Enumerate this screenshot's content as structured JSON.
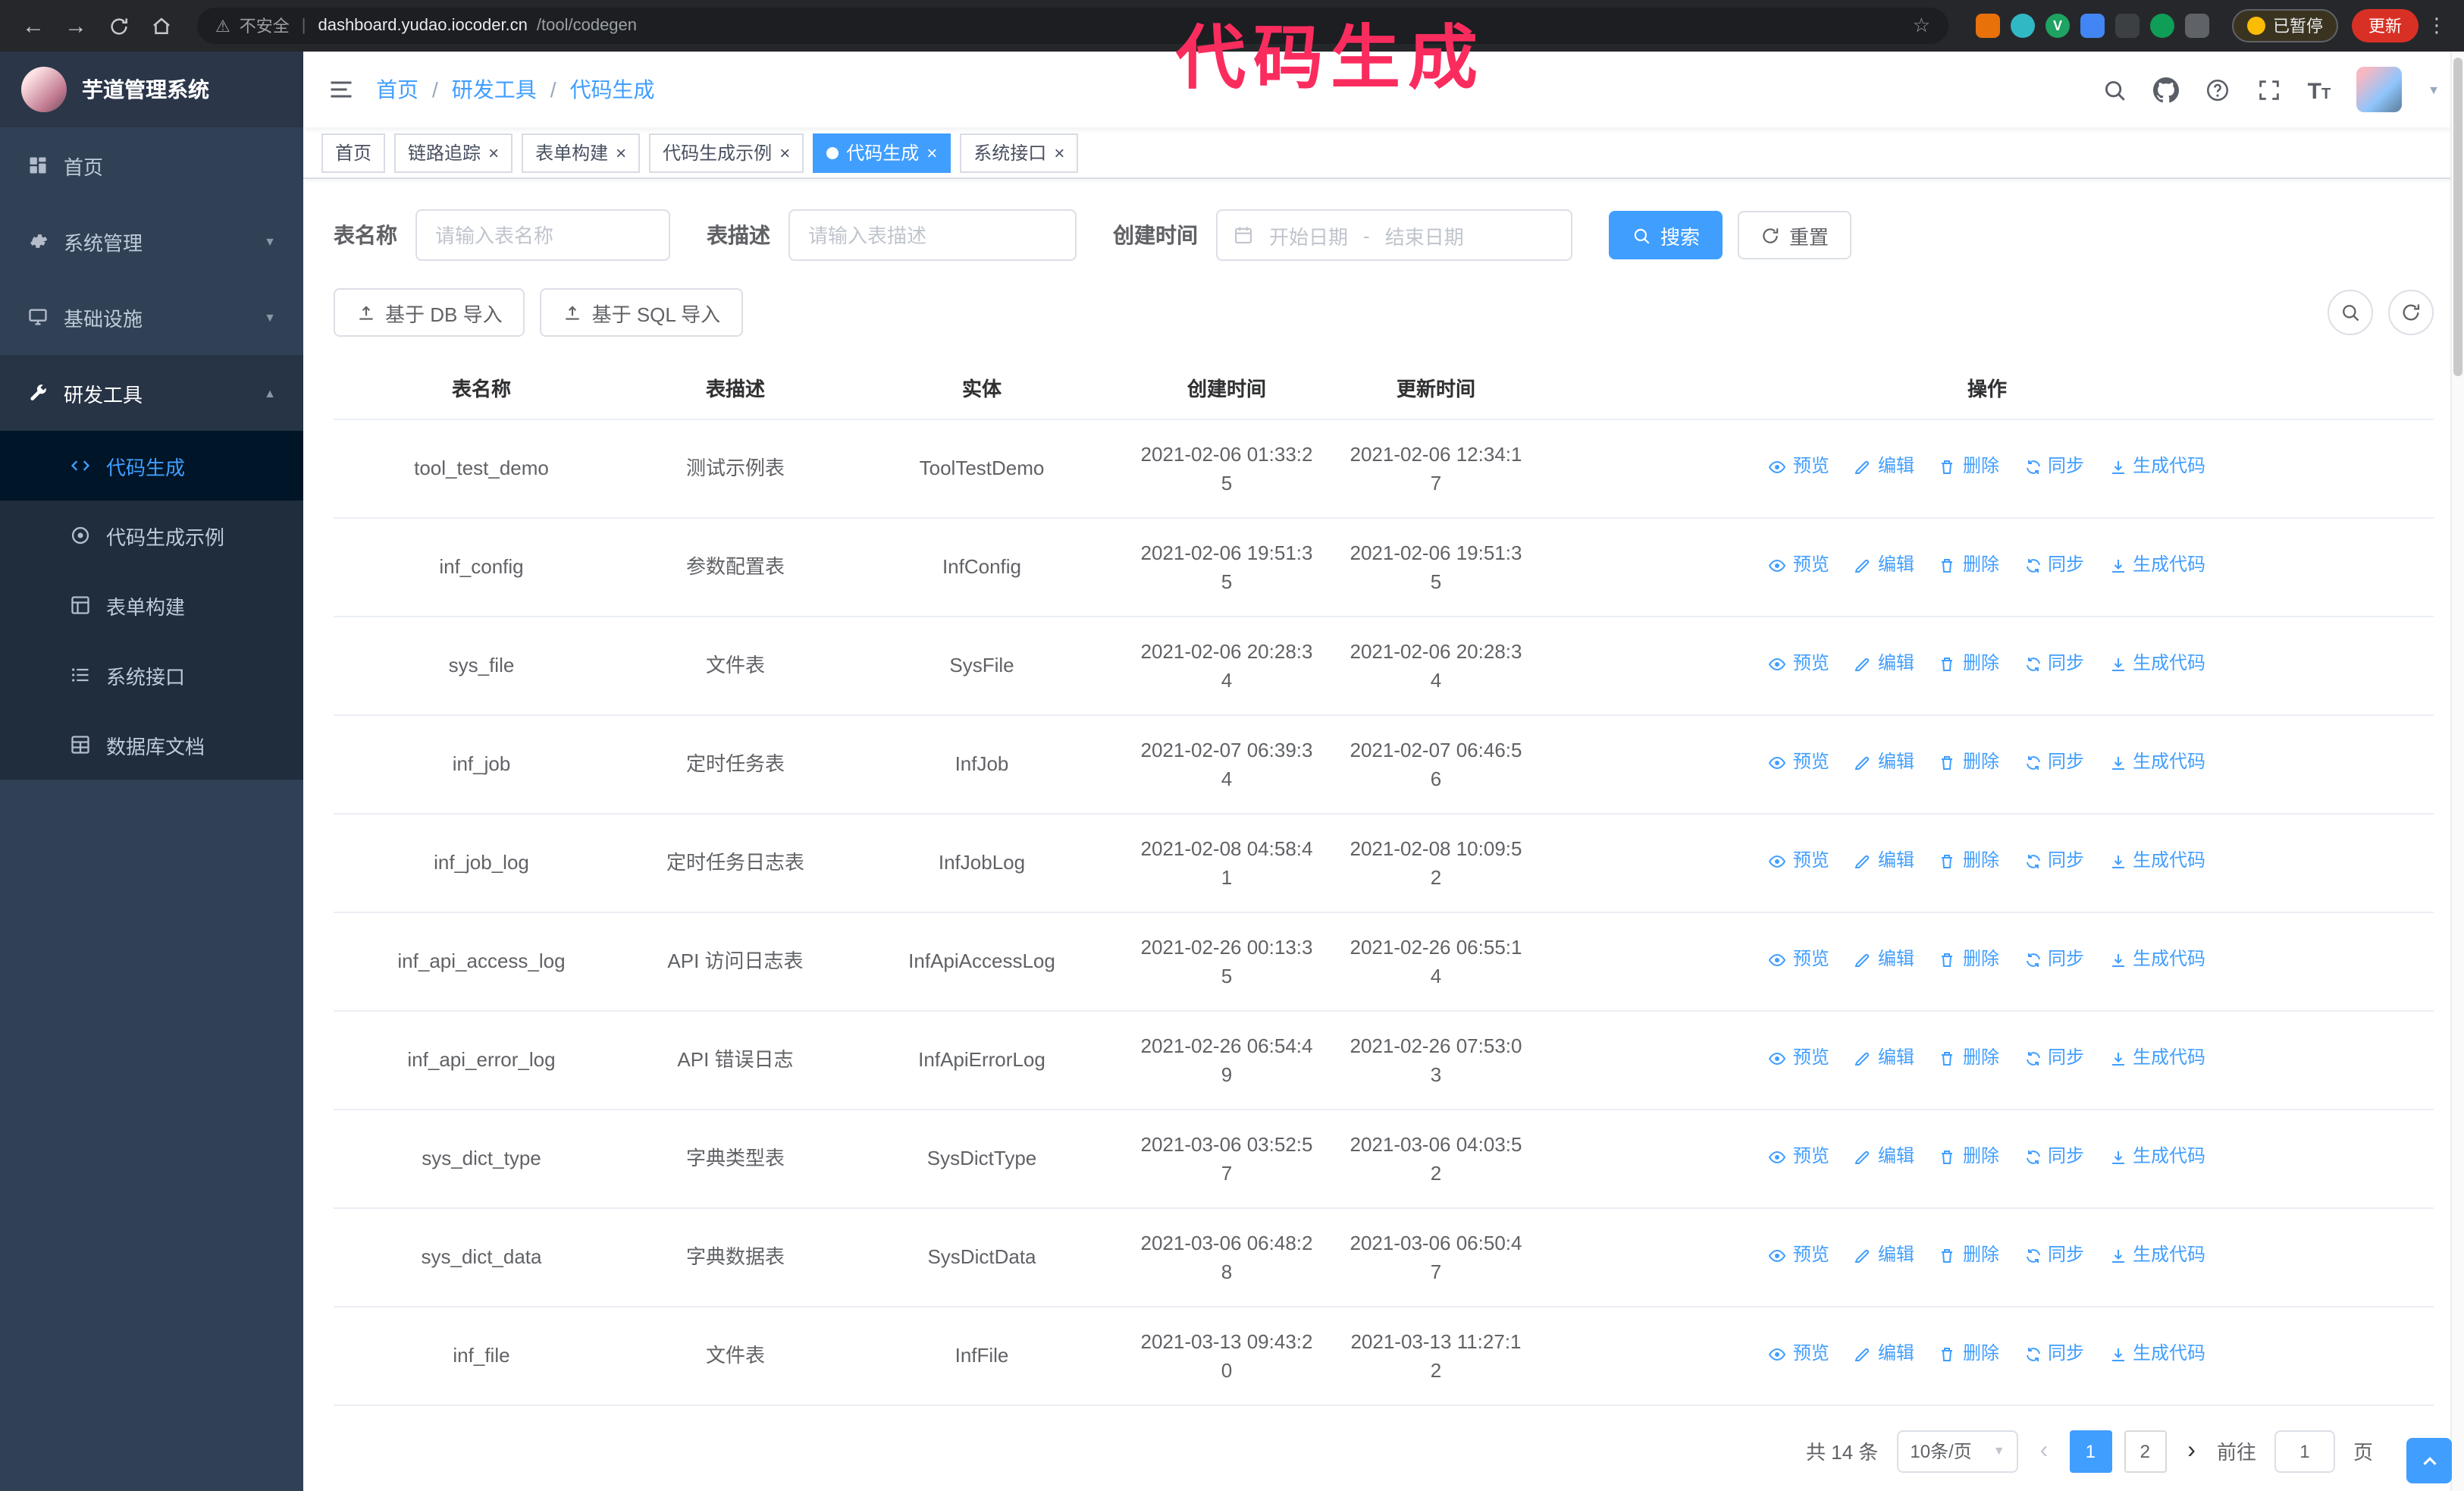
{
  "annotation": {
    "text": "代码生成"
  },
  "colors": {
    "primary": "#409eff",
    "sidebar_bg": "#304156",
    "submenu_bg": "#1f2d3d",
    "sidebar_active_bg": "#001528",
    "annotation": "#fa2c5e",
    "chrome_bg": "#26272b",
    "update_button": "#d93025"
  },
  "browser": {
    "security_label": "不安全",
    "url_host": "dashboard.yudao.iocoder.cn",
    "url_path": "/tool/codegen",
    "paused_label": "已暂停",
    "update_label": "更新",
    "extensions": [
      {
        "id": "fox-extension-icon",
        "color": "#e8710a",
        "shape": "square",
        "letter": ""
      },
      {
        "id": "teal-extension-icon",
        "color": "#30b8c4",
        "shape": "round",
        "letter": ""
      },
      {
        "id": "green-v-extension-icon",
        "color": "#1ea362",
        "shape": "round",
        "letter": "V"
      },
      {
        "id": "blue-grid-extension-icon",
        "color": "#4285f4",
        "shape": "square",
        "letter": ""
      },
      {
        "id": "dark-extension-icon",
        "color": "#3c4043",
        "shape": "square",
        "letter": ""
      },
      {
        "id": "leaf-extension-icon",
        "color": "#0f9d58",
        "shape": "round",
        "letter": ""
      },
      {
        "id": "grey-pin-extension-icon",
        "color": "#5f6368",
        "shape": "square",
        "letter": ""
      }
    ]
  },
  "sidebar": {
    "logo_title": "芋道管理系统",
    "items": [
      {
        "id": "home",
        "label": "首页",
        "icon": "dashboard"
      },
      {
        "id": "system-management",
        "label": "系统管理",
        "icon": "gear",
        "chevron": "down"
      },
      {
        "id": "infrastructure",
        "label": "基础设施",
        "icon": "monitor",
        "chevron": "down"
      },
      {
        "id": "dev-tools",
        "label": "研发工具",
        "icon": "wrench",
        "chevron": "up",
        "expanded": true
      }
    ],
    "subitems": [
      {
        "id": "codegen",
        "label": "代码生成",
        "icon": "code",
        "active": true
      },
      {
        "id": "codegen-example",
        "label": "代码生成示例",
        "icon": "target"
      },
      {
        "id": "form-builder",
        "label": "表单构建",
        "icon": "form"
      },
      {
        "id": "system-api",
        "label": "系统接口",
        "icon": "list"
      },
      {
        "id": "db-doc",
        "label": "数据库文档",
        "icon": "db"
      }
    ]
  },
  "header": {
    "breadcrumb": [
      "首页",
      "研发工具",
      "代码生成"
    ]
  },
  "tabs": [
    {
      "id": "home",
      "label": "首页",
      "closable": false,
      "active": false
    },
    {
      "id": "tracing",
      "label": "链路追踪",
      "closable": true,
      "active": false
    },
    {
      "id": "form-builder",
      "label": "表单构建",
      "closable": true,
      "active": false
    },
    {
      "id": "codegen-example",
      "label": "代码生成示例",
      "closable": true,
      "active": false
    },
    {
      "id": "codegen",
      "label": "代码生成",
      "closable": true,
      "active": true
    },
    {
      "id": "system-api",
      "label": "系统接口",
      "closable": true,
      "active": false
    }
  ],
  "filters": {
    "table_name_label": "表名称",
    "table_name_placeholder": "请输入表名称",
    "table_desc_label": "表描述",
    "table_desc_placeholder": "请输入表描述",
    "create_time_label": "创建时间",
    "date_start_placeholder": "开始日期",
    "date_separator": "-",
    "date_end_placeholder": "结束日期",
    "search_button": "搜索",
    "reset_button": "重置"
  },
  "toolbar": {
    "import_db_label": "基于 DB 导入",
    "import_sql_label": "基于 SQL 导入"
  },
  "table": {
    "columns": [
      "表名称",
      "表描述",
      "实体",
      "创建时间",
      "更新时间",
      "操作"
    ],
    "actions": [
      "预览",
      "编辑",
      "删除",
      "同步",
      "生成代码"
    ],
    "action_names": [
      "preview",
      "edit",
      "delete",
      "sync",
      "generate-code"
    ],
    "action_icons": [
      "eye-icon",
      "edit-icon",
      "trash-icon",
      "sync-icon",
      "download-icon"
    ],
    "rows": [
      {
        "name": "tool_test_demo",
        "desc": "测试示例表",
        "entity": "ToolTestDemo",
        "created": "2021-02-06 01:33:25",
        "updated": "2021-02-06 12:34:17"
      },
      {
        "name": "inf_config",
        "desc": "参数配置表",
        "entity": "InfConfig",
        "created": "2021-02-06 19:51:35",
        "updated": "2021-02-06 19:51:35"
      },
      {
        "name": "sys_file",
        "desc": "文件表",
        "entity": "SysFile",
        "created": "2021-02-06 20:28:34",
        "updated": "2021-02-06 20:28:34"
      },
      {
        "name": "inf_job",
        "desc": "定时任务表",
        "entity": "InfJob",
        "created": "2021-02-07 06:39:34",
        "updated": "2021-02-07 06:46:56"
      },
      {
        "name": "inf_job_log",
        "desc": "定时任务日志表",
        "entity": "InfJobLog",
        "created": "2021-02-08 04:58:41",
        "updated": "2021-02-08 10:09:52"
      },
      {
        "name": "inf_api_access_log",
        "desc": "API 访问日志表",
        "entity": "InfApiAccessLog",
        "created": "2021-02-26 00:13:35",
        "updated": "2021-02-26 06:55:14"
      },
      {
        "name": "inf_api_error_log",
        "desc": "API 错误日志",
        "entity": "InfApiErrorLog",
        "created": "2021-02-26 06:54:49",
        "updated": "2021-02-26 07:53:03"
      },
      {
        "name": "sys_dict_type",
        "desc": "字典类型表",
        "entity": "SysDictType",
        "created": "2021-03-06 03:52:57",
        "updated": "2021-03-06 04:03:52"
      },
      {
        "name": "sys_dict_data",
        "desc": "字典数据表",
        "entity": "SysDictData",
        "created": "2021-03-06 06:48:28",
        "updated": "2021-03-06 06:50:47"
      },
      {
        "name": "inf_file",
        "desc": "文件表",
        "entity": "InfFile",
        "created": "2021-03-13 09:43:20",
        "updated": "2021-03-13 11:27:12"
      }
    ]
  },
  "pagination": {
    "total_label": "共 14 条",
    "page_size_label": "10条/页",
    "pages": [
      "1",
      "2"
    ],
    "active_page": "1",
    "goto_prefix": "前往",
    "goto_value": "1",
    "goto_suffix": "页"
  }
}
